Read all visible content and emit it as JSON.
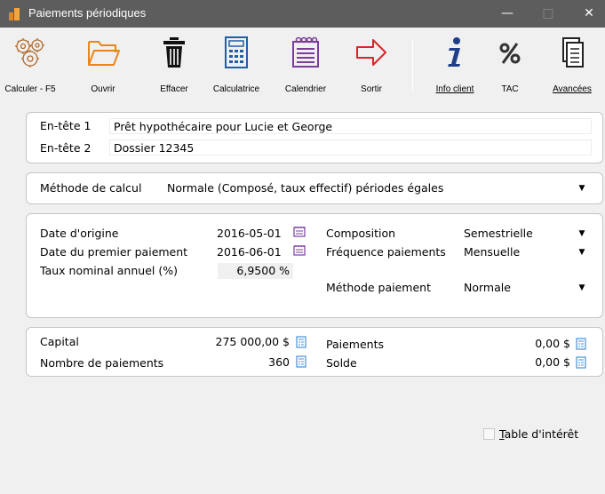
{
  "window": {
    "title": "Paiements périodiques",
    "min": "—",
    "max": "□",
    "close": "✕"
  },
  "toolbar": {
    "calculer": "Calculer - F5",
    "ouvrir": "Ouvrir",
    "effacer": "Effacer",
    "calculatrice": "Calculatrice",
    "calendrier": "Calendrier",
    "sortir": "Sortir",
    "info_client": "Info client",
    "tac": "TAC",
    "avancees": "Avancées"
  },
  "headers": {
    "label1": "En-tête 1",
    "value1": "Prêt hypothécaire pour Lucie et George",
    "label2": "En-tête 2",
    "value2": "Dossier 12345"
  },
  "method": {
    "label": "Méthode de calcul",
    "value": "Normale (Composé, taux effectif) périodes égales"
  },
  "dates": {
    "date_origine_label": "Date d'origine",
    "date_origine": "2016-05-01",
    "date_premier_label": "Date du premier paiement",
    "date_premier": "2016-06-01",
    "taux_label": "Taux nominal annuel (%)",
    "taux": "6,9500 %",
    "composition_label": "Composition",
    "composition": "Semestrielle",
    "frequence_label": "Fréquence paiements",
    "frequence": "Mensuelle",
    "methode_paiement_label": "Méthode paiement",
    "methode_paiement": "Normale"
  },
  "amounts": {
    "capital_label": "Capital",
    "capital": "275 000,00 $",
    "nb_paiements_label": "Nombre de paiements",
    "nb_paiements": "360",
    "paiements_label": "Paiements",
    "paiements": "0,00 $",
    "solde_label": "Solde",
    "solde": "0,00 $"
  },
  "footer": {
    "table_interet_first": "T",
    "table_interet_rest": "able d'intérêt",
    "checked": false
  },
  "colors": {
    "titlebar": "#5d5d5d",
    "accent_orange": "#e8861a",
    "accent_purple": "#7a3d9c",
    "accent_red": "#d9252a",
    "accent_blue": "#1f5fa8"
  }
}
